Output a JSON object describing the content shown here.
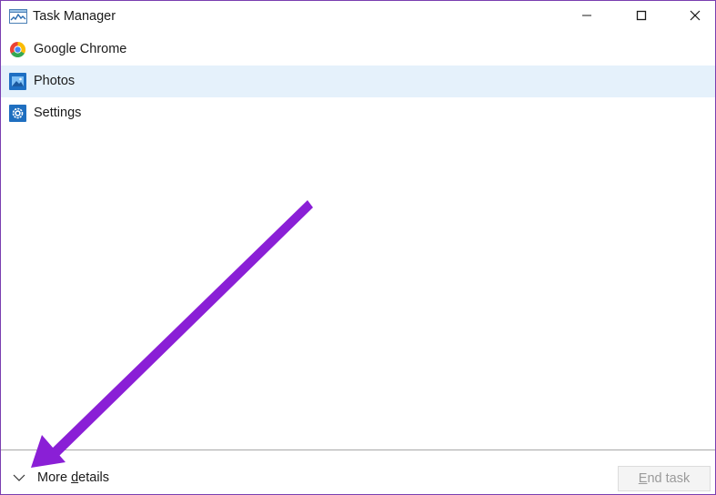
{
  "window": {
    "title": "Task Manager",
    "icon": "task-manager-icon",
    "border_color": "#7a3fb0"
  },
  "title_buttons": {
    "minimize": "minimize-icon",
    "maximize": "maximize-icon",
    "close": "close-icon"
  },
  "processes": [
    {
      "label": "Google Chrome",
      "icon": "chrome-icon",
      "selected": false
    },
    {
      "label": "Photos",
      "icon": "photos-icon",
      "selected": true
    },
    {
      "label": "Settings",
      "icon": "settings-icon",
      "selected": false
    }
  ],
  "footer": {
    "more_details": {
      "prefix": "More ",
      "underlined": "d",
      "suffix": "etails",
      "icon": "chevron-down-icon"
    },
    "end_task": {
      "underlined": "E",
      "suffix": "nd task",
      "enabled": false
    }
  },
  "colors": {
    "selection": "#e5f1fb",
    "annotation_arrow": "#8a1fd6"
  }
}
